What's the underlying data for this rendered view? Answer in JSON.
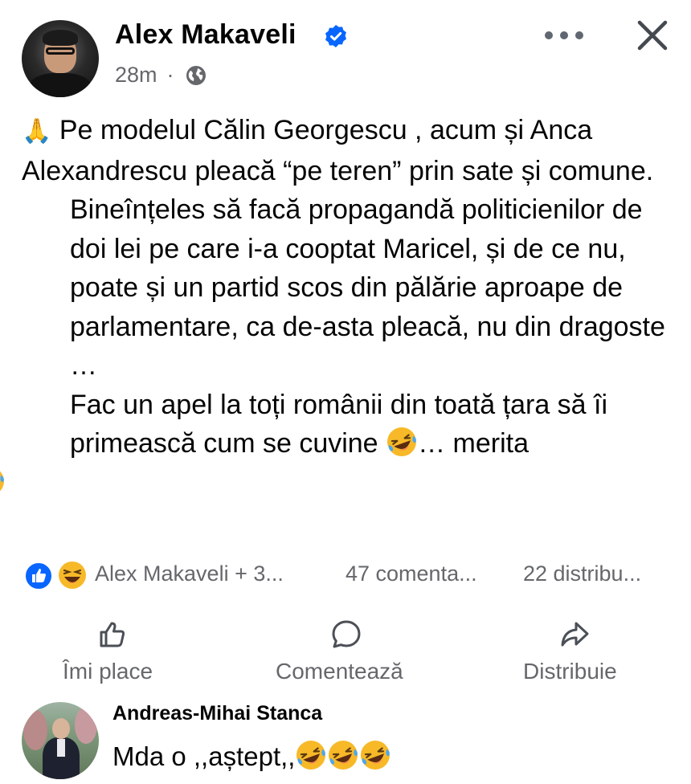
{
  "post": {
    "author": "Alex Makaveli",
    "time": "28m",
    "separator": "·",
    "privacy_icon": "globe-icon",
    "verified_icon": "verified-badge-icon",
    "body": {
      "p1_emoji": "🙏",
      "p1": "Pe modelul Călin Georgescu , acum și Anca Alexandrescu pleacă “pe teren” prin sate și comune.",
      "p2": "Bineînțeles să facă propagandă politicienilor de doi lei pe care i-a cooptat Maricel, și de ce nu, poate și un partid scos din pălărie aproape de parlamentare, ca de-asta pleacă, nu din dragoste …",
      "p3a": "Fac un apel la toți românii din toată țara să îi primească cum se cuvine",
      "p3b": "… merita"
    }
  },
  "stats": {
    "reactions": [
      "like",
      "haha"
    ],
    "names": "Alex Makaveli + 3...",
    "comments": "47 comenta...",
    "shares": "22 distribu..."
  },
  "actions": {
    "like": "Îmi place",
    "comment": "Comentează",
    "share": "Distribuie"
  },
  "comment": {
    "author": "Andreas-Mihai Stanca",
    "text": "Mda o ,,aștept,,",
    "emoji_count": 3
  },
  "colors": {
    "text": "#050505",
    "secondary": "#65676b",
    "facebook_blue": "#0866ff",
    "haha_yellow": "#f7b125"
  }
}
